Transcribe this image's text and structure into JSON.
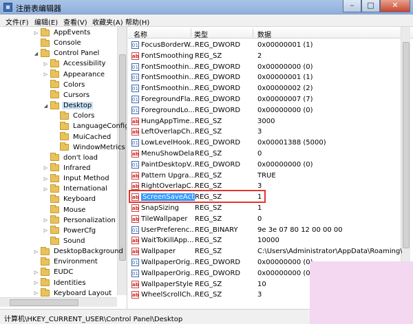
{
  "window": {
    "title": "注册表编辑器"
  },
  "menu": [
    "文件(F)",
    "编辑(E)",
    "查看(V)",
    "收藏夹(A)",
    "帮助(H)"
  ],
  "tree": [
    {
      "label": "AppEvents",
      "arrow": "▷",
      "indent": 48
    },
    {
      "label": "Console",
      "arrow": "",
      "indent": 48
    },
    {
      "label": "Control Panel",
      "arrow": "◢",
      "indent": 48
    },
    {
      "label": "Accessibility",
      "arrow": "▷",
      "indent": 62
    },
    {
      "label": "Appearance",
      "arrow": "▷",
      "indent": 62
    },
    {
      "label": "Colors",
      "arrow": "",
      "indent": 62
    },
    {
      "label": "Cursors",
      "arrow": "",
      "indent": 62
    },
    {
      "label": "Desktop",
      "arrow": "◢",
      "indent": 62,
      "selected": true
    },
    {
      "label": "Colors",
      "arrow": "",
      "indent": 76
    },
    {
      "label": "LanguageConfig",
      "arrow": "",
      "indent": 76
    },
    {
      "label": "MuiCached",
      "arrow": "",
      "indent": 76
    },
    {
      "label": "WindowMetrics",
      "arrow": "",
      "indent": 76
    },
    {
      "label": "don't load",
      "arrow": "",
      "indent": 62
    },
    {
      "label": "Infrared",
      "arrow": "▷",
      "indent": 62
    },
    {
      "label": "Input Method",
      "arrow": "▷",
      "indent": 62
    },
    {
      "label": "International",
      "arrow": "▷",
      "indent": 62
    },
    {
      "label": "Keyboard",
      "arrow": "",
      "indent": 62
    },
    {
      "label": "Mouse",
      "arrow": "",
      "indent": 62
    },
    {
      "label": "Personalization",
      "arrow": "▷",
      "indent": 62
    },
    {
      "label": "PowerCfg",
      "arrow": "▷",
      "indent": 62
    },
    {
      "label": "Sound",
      "arrow": "",
      "indent": 62
    },
    {
      "label": "DesktopBackground",
      "arrow": "▷",
      "indent": 48
    },
    {
      "label": "Environment",
      "arrow": "",
      "indent": 48
    },
    {
      "label": "EUDC",
      "arrow": "▷",
      "indent": 48
    },
    {
      "label": "Identities",
      "arrow": "▷",
      "indent": 48
    },
    {
      "label": "Keyboard Layout",
      "arrow": "▷",
      "indent": 48
    }
  ],
  "columns": {
    "name": "名称",
    "type": "类型",
    "data": "数据"
  },
  "rows": [
    {
      "name": "FocusBorderW...",
      "type": "REG_DWORD",
      "data": "0x00000001 (1)",
      "icon": "bin"
    },
    {
      "name": "FontSmoothing",
      "type": "REG_SZ",
      "data": "2",
      "icon": "sz"
    },
    {
      "name": "FontSmoothin...",
      "type": "REG_DWORD",
      "data": "0x00000000 (0)",
      "icon": "bin"
    },
    {
      "name": "FontSmoothin...",
      "type": "REG_DWORD",
      "data": "0x00000001 (1)",
      "icon": "bin"
    },
    {
      "name": "FontSmoothin...",
      "type": "REG_DWORD",
      "data": "0x00000002 (2)",
      "icon": "bin"
    },
    {
      "name": "ForegroundFla...",
      "type": "REG_DWORD",
      "data": "0x00000007 (7)",
      "icon": "bin"
    },
    {
      "name": "ForegroundLo...",
      "type": "REG_DWORD",
      "data": "0x00000000 (0)",
      "icon": "bin"
    },
    {
      "name": "HungAppTime...",
      "type": "REG_SZ",
      "data": "3000",
      "icon": "sz"
    },
    {
      "name": "LeftOverlapCh...",
      "type": "REG_SZ",
      "data": "3",
      "icon": "sz"
    },
    {
      "name": "LowLevelHook...",
      "type": "REG_DWORD",
      "data": "0x00001388 (5000)",
      "icon": "bin"
    },
    {
      "name": "MenuShowDelay",
      "type": "REG_SZ",
      "data": "0",
      "icon": "sz"
    },
    {
      "name": "PaintDesktopV...",
      "type": "REG_DWORD",
      "data": "0x00000000 (0)",
      "icon": "bin"
    },
    {
      "name": "Pattern Upgra...",
      "type": "REG_SZ",
      "data": "TRUE",
      "icon": "sz"
    },
    {
      "name": "RightOverlapC...",
      "type": "REG_SZ",
      "data": "3",
      "icon": "sz"
    },
    {
      "name": "ScreenSaveActi...",
      "type": "REG_SZ",
      "data": "1",
      "icon": "sz",
      "selected": true
    },
    {
      "name": "SnapSizing",
      "type": "REG_SZ",
      "data": "1",
      "icon": "sz"
    },
    {
      "name": "TileWallpaper",
      "type": "REG_SZ",
      "data": "0",
      "icon": "sz"
    },
    {
      "name": "UserPreferenc...",
      "type": "REG_BINARY",
      "data": "9e 3e 07 80 12 00 00 00",
      "icon": "bin"
    },
    {
      "name": "WaitToKillApp...",
      "type": "REG_SZ",
      "data": "10000",
      "icon": "sz"
    },
    {
      "name": "Wallpaper",
      "type": "REG_SZ",
      "data": "C:\\Users\\Administrator\\AppData\\Roaming\\Mi...",
      "icon": "sz"
    },
    {
      "name": "WallpaperOrig...",
      "type": "REG_DWORD",
      "data": "0x00000000 (0)",
      "icon": "bin"
    },
    {
      "name": "WallpaperOrig...",
      "type": "REG_DWORD",
      "data": "0x00000000 (0)",
      "icon": "bin"
    },
    {
      "name": "WallpaperStyle",
      "type": "REG_SZ",
      "data": "10",
      "icon": "sz"
    },
    {
      "name": "WheelScrollCh...",
      "type": "REG_SZ",
      "data": "3",
      "icon": "sz"
    }
  ],
  "status": "计算机\\HKEY_CURRENT_USER\\Control Panel\\Desktop",
  "colors": {
    "selection": "#3399ff",
    "highlight_box": "#e0352a",
    "corner": "#f4d7f1"
  }
}
